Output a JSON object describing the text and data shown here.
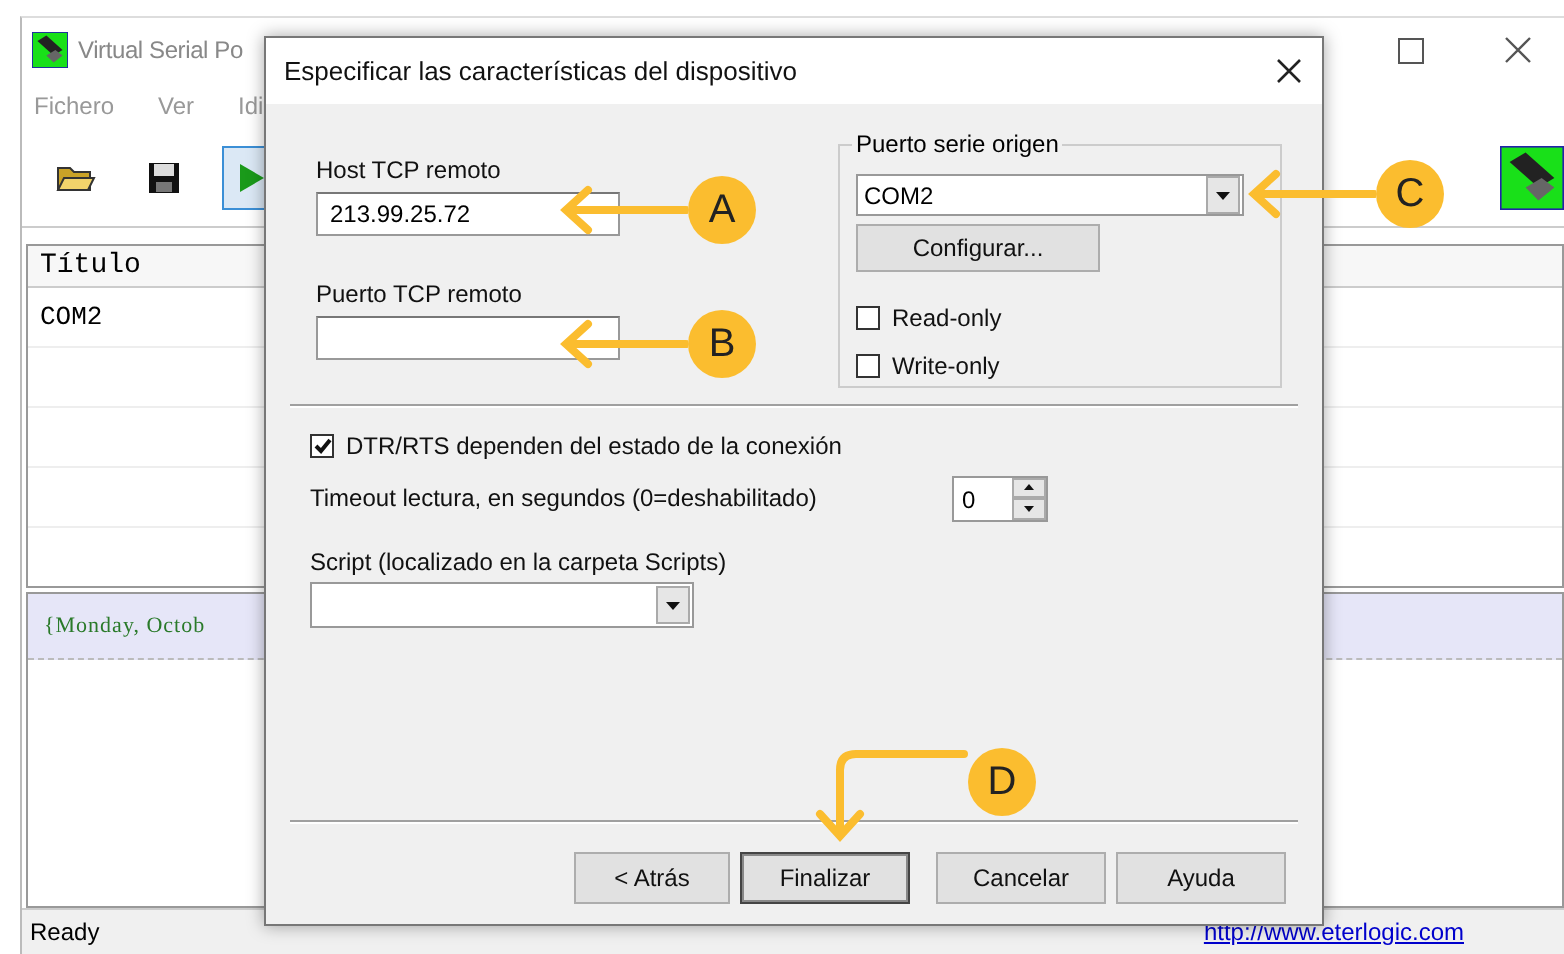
{
  "main_window": {
    "title": "Virtual Serial Po",
    "menu": [
      "Fichero",
      "Ver",
      "Idi"
    ],
    "table": {
      "columns": [
        "Título"
      ],
      "rows": [
        "COM2"
      ]
    },
    "log": [
      "{Monday, Octob"
    ],
    "status_bar": {
      "text": "Ready",
      "link": "http://www.eterlogic.com"
    }
  },
  "dialog": {
    "title": "Especificar las características del dispositivo",
    "host": {
      "label": "Host TCP remoto",
      "value": "213.99.25.72"
    },
    "port": {
      "label": "Puerto TCP remoto"
    },
    "serial_group": {
      "title": "Puerto serie origen",
      "combo_value": "COM2",
      "configure_button": "Configurar...",
      "checkboxes": [
        {
          "label": "Read-only",
          "checked": false
        },
        {
          "label": "Write-only",
          "checked": false
        }
      ]
    },
    "dtr": {
      "label": "DTR/RTS dependen del estado de la conexión",
      "checked": true
    },
    "timeout": {
      "label": "Timeout lectura, en segundos (0=deshabilitado)",
      "value": "0"
    },
    "script": {
      "label": "Script (localizado en la carpeta Scripts)"
    },
    "buttons": [
      {
        "label": "< Atrás",
        "default": false
      },
      {
        "label": "Finalizar",
        "default": true
      },
      {
        "label": "Cancelar",
        "default": false
      },
      {
        "label": "Ayuda",
        "default": false
      }
    ]
  },
  "callouts": [
    {
      "letter": "A",
      "kind": "left"
    },
    {
      "letter": "B",
      "kind": "left"
    },
    {
      "letter": "C",
      "kind": "left"
    },
    {
      "letter": "D",
      "kind": "bent"
    }
  ]
}
